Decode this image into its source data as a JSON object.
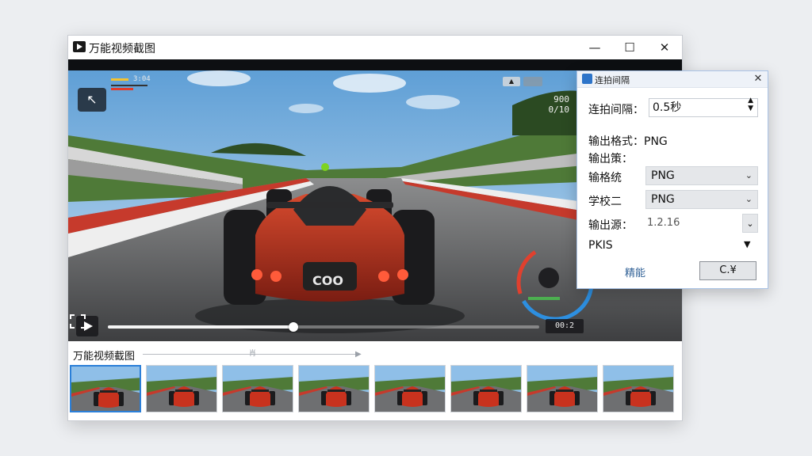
{
  "window": {
    "title": "万能视频截图",
    "minimize_glyph": "—",
    "maximize_glyph": "☐",
    "close_glyph": "✕"
  },
  "player": {
    "hud_left_text": "3:04",
    "hud_right_button": "▲",
    "hud_right_number": "900\n0/10",
    "dash_number": "COO",
    "time": "00:2",
    "progress_fraction": 0.43,
    "nav_icon": "cursor-pointer-icon"
  },
  "filmstrip": {
    "label": "万能视频截图",
    "tick": "肖",
    "thumb_count": 8,
    "selected_index": 0
  },
  "dialog": {
    "title": "连拍间隔",
    "close_glyph": "✕",
    "interval_label": "连拍间隔：",
    "interval_value": "0.5秒",
    "format_label": "输出格式：PNG",
    "output_label": "输出策：",
    "row1_label": "输格统",
    "row1_value": "PNG",
    "row2_label": "学校二",
    "row2_value": "PNG",
    "row3_label": "输出源：",
    "row3_value": "1.2.16",
    "row4_label": "PKIS",
    "link_button": "精能",
    "ok_button": "C.¥"
  },
  "colors": {
    "accent": "#2b7fd8",
    "car_red": "#c8321e",
    "sky": "#8fbfe8"
  }
}
